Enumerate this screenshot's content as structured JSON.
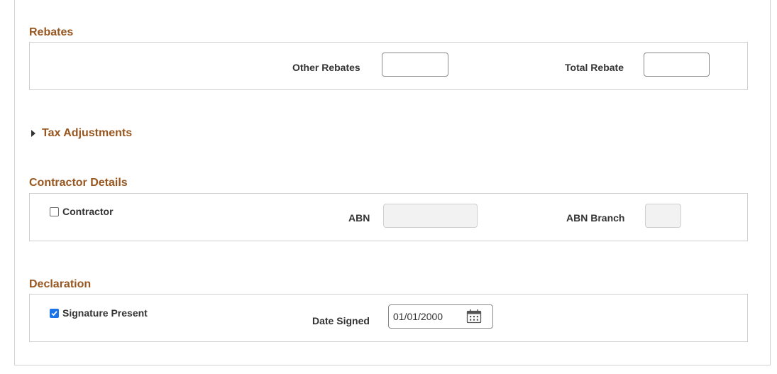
{
  "rebates": {
    "title": "Rebates",
    "other_rebates_label": "Other Rebates",
    "other_rebates_value": "",
    "total_rebate_label": "Total Rebate",
    "total_rebate_value": ""
  },
  "tax_adjustments": {
    "title": "Tax Adjustments",
    "expanded": false
  },
  "contractor": {
    "title": "Contractor Details",
    "contractor_label": "Contractor",
    "contractor_checked": false,
    "abn_label": "ABN",
    "abn_value": "",
    "abn_branch_label": "ABN Branch",
    "abn_branch_value": ""
  },
  "declaration": {
    "title": "Declaration",
    "signature_label": "Signature Present",
    "signature_checked": true,
    "date_signed_label": "Date Signed",
    "date_signed_value": "01/01/2000"
  },
  "colors": {
    "section_title": "#97561f",
    "checkbox_checked": "#1a73e8",
    "border": "#cfcfcf"
  },
  "icons": {
    "expander": "triangle-right-icon",
    "calendar": "calendar-icon"
  }
}
